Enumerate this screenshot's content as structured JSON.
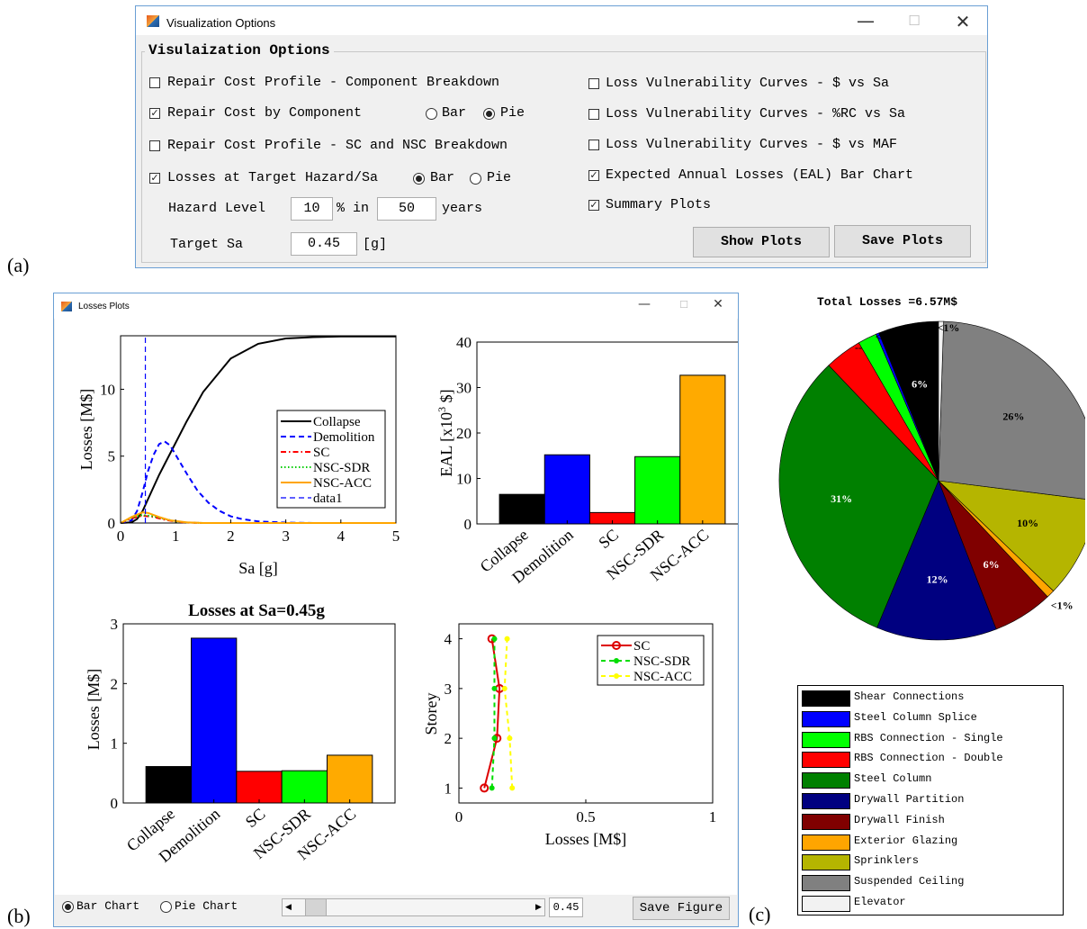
{
  "panel_labels": {
    "a": "(a)",
    "b": "(b)",
    "c": "(c)"
  },
  "options_window": {
    "title": "Visualization Options",
    "group_title": "Visulaization Options",
    "left_options": [
      {
        "label": "Repair Cost Profile - Component Breakdown",
        "checked": false
      },
      {
        "label": "Repair Cost by Component",
        "checked": true
      },
      {
        "label": "Repair Cost Profile - SC and NSC Breakdown",
        "checked": false
      },
      {
        "label": "Losses at Target Hazard/Sa",
        "checked": true
      }
    ],
    "component_chart": {
      "bar_label": "Bar",
      "pie_label": "Pie",
      "selected": "Pie"
    },
    "hazard_chart": {
      "bar_label": "Bar",
      "pie_label": "Pie",
      "selected": "Bar"
    },
    "right_options": [
      {
        "label": "Loss Vulnerability Curves - $ vs Sa",
        "checked": false
      },
      {
        "label": "Loss Vulnerability Curves - %RC vs Sa",
        "checked": false
      },
      {
        "label": "Loss Vulnerability Curves - $ vs MAF",
        "checked": false
      },
      {
        "label": "Expected Annual Losses (EAL) Bar Chart",
        "checked": true
      },
      {
        "label": "Summary Plots",
        "checked": true
      }
    ],
    "hazard_level_label": "Hazard Level",
    "hazard_percent": "10",
    "percent_in_label": "% in",
    "hazard_years": "50",
    "years_label": "years",
    "target_sa_label": "Target Sa",
    "target_sa_value": "0.45",
    "target_sa_unit": "[g]",
    "show_plots_label": "Show Plots",
    "save_plots_label": "Save Plots"
  },
  "plots_window": {
    "title": "Losses Plots",
    "bar_chart_label": "Bar Chart",
    "pie_chart_label": "Pie Chart",
    "selected_mode": "Bar Chart",
    "slider_value": 0.1,
    "slider_readout": "0.45",
    "save_figure_label": "Save Figure"
  },
  "summary_pie_title": "Total Losses =6.57M$",
  "chart_data": [
    {
      "id": "losses-vs-sa",
      "type": "line",
      "xlabel": "Sa [g]",
      "ylabel": "Losses [M$]",
      "xlim": [
        0,
        5
      ],
      "ylim": [
        0,
        14
      ],
      "xticks": [
        "0",
        "1",
        "2",
        "3",
        "4",
        "5"
      ],
      "yticks": [
        "0",
        "5",
        "10"
      ],
      "legend_position": "right",
      "series": [
        {
          "name": "Collapse",
          "color": "#000000",
          "dash": "solid",
          "x": [
            0,
            0.2,
            0.3,
            0.4,
            0.5,
            0.6,
            0.7,
            0.8,
            1.0,
            1.2,
            1.5,
            2.0,
            2.5,
            3.0,
            3.5,
            4.0,
            5.0
          ],
          "y": [
            0,
            0.05,
            0.3,
            0.9,
            1.8,
            2.7,
            3.6,
            4.4,
            6.0,
            7.6,
            9.8,
            12.3,
            13.4,
            13.8,
            13.9,
            13.95,
            13.95
          ]
        },
        {
          "name": "Demolition",
          "color": "#0000ff",
          "dash": "dashed",
          "x": [
            0,
            0.2,
            0.3,
            0.4,
            0.5,
            0.6,
            0.7,
            0.8,
            0.9,
            1.0,
            1.2,
            1.4,
            1.6,
            1.8,
            2.0,
            2.2,
            2.5,
            3.0,
            3.5,
            5.0
          ],
          "y": [
            0,
            0.2,
            0.9,
            2.3,
            3.9,
            5.1,
            5.9,
            6.1,
            5.8,
            5.1,
            3.7,
            2.4,
            1.5,
            0.9,
            0.5,
            0.3,
            0.12,
            0.03,
            0,
            0
          ]
        },
        {
          "name": "SC",
          "color": "#ff0000",
          "dash": "dashdot",
          "x": [
            0,
            0.2,
            0.4,
            0.6,
            0.8,
            1.0,
            1.2,
            1.5,
            5.0
          ],
          "y": [
            0,
            0.35,
            0.55,
            0.45,
            0.25,
            0.1,
            0.03,
            0,
            0
          ]
        },
        {
          "name": "NSC-SDR",
          "color": "#00cc00",
          "dash": "dotted",
          "x": [
            0,
            0.2,
            0.4,
            0.6,
            0.8,
            1.0,
            1.2,
            1.5,
            5.0
          ],
          "y": [
            0,
            0.4,
            0.6,
            0.5,
            0.3,
            0.12,
            0.04,
            0,
            0
          ]
        },
        {
          "name": "NSC-ACC",
          "color": "#ffa500",
          "dash": "solid",
          "x": [
            0,
            0.2,
            0.4,
            0.5,
            0.7,
            0.9,
            1.2,
            1.5,
            5.0
          ],
          "y": [
            0,
            0.45,
            0.8,
            0.75,
            0.45,
            0.2,
            0.05,
            0,
            0
          ]
        },
        {
          "name": "data1",
          "color": "#0000ff",
          "dash": "dashed",
          "x": [
            0.45,
            0.45
          ],
          "y": [
            0,
            14
          ]
        }
      ]
    },
    {
      "id": "eal-bar",
      "type": "bar",
      "ylabel": "EAL [x10^3 $]",
      "ylim": [
        0,
        40
      ],
      "yticks": [
        "0",
        "10",
        "20",
        "30",
        "40"
      ],
      "categories": [
        "Collapse",
        "Demolition",
        "SC",
        "NSC-SDR",
        "NSC-ACC"
      ],
      "values": [
        6.5,
        15.2,
        2.5,
        14.8,
        32.7
      ],
      "colors": [
        "#000000",
        "#0000ff",
        "#ff0000",
        "#00ff00",
        "#ffaa00"
      ]
    },
    {
      "id": "losses-at-sa-bar",
      "type": "bar",
      "title": "Losses at Sa=0.45g",
      "ylabel": "Losses [M$]",
      "ylim": [
        0,
        3
      ],
      "yticks": [
        "0",
        "1",
        "2",
        "3"
      ],
      "categories": [
        "Collapse",
        "Demolition",
        "SC",
        "NSC-SDR",
        "NSC-ACC"
      ],
      "values": [
        0.61,
        2.76,
        0.53,
        0.54,
        0.8
      ],
      "colors": [
        "#000000",
        "#0000ff",
        "#ff0000",
        "#00ff00",
        "#ffaa00"
      ]
    },
    {
      "id": "storey-profile",
      "type": "line",
      "xlabel": "Losses [M$]",
      "ylabel": "Storey",
      "xlim": [
        0,
        1
      ],
      "ylim": [
        0.7,
        4.3
      ],
      "xticks": [
        "0",
        "0.5",
        "1"
      ],
      "yticks": [
        "1",
        "2",
        "3",
        "4"
      ],
      "legend_position": "top-right",
      "series": [
        {
          "name": "SC",
          "color": "#dd0000",
          "marker": "circle",
          "x": [
            0.1,
            0.15,
            0.16,
            0.13
          ],
          "y": [
            1,
            2,
            3,
            4
          ]
        },
        {
          "name": "NSC-SDR",
          "color": "#00dd00",
          "marker": "dot",
          "x": [
            0.13,
            0.14,
            0.14,
            0.14
          ],
          "y": [
            1,
            2,
            3,
            4
          ]
        },
        {
          "name": "NSC-ACC",
          "color": "#ffff00",
          "marker": "dot",
          "x": [
            0.21,
            0.2,
            0.18,
            0.19
          ],
          "y": [
            1,
            2,
            3,
            4
          ]
        }
      ]
    },
    {
      "id": "component-pie",
      "type": "pie",
      "title": "Total Losses =6.57M$",
      "slices": [
        {
          "name": "Shear Connections",
          "percent": 6,
          "label": "6%",
          "color": "#000000"
        },
        {
          "name": "Steel Column Splice",
          "percent": 0.3,
          "label": "",
          "color": "#0000ff"
        },
        {
          "name": "RBS Connection - Single",
          "percent": 1.9,
          "label": "",
          "color": "#00ff00"
        },
        {
          "name": "RBS Connection - Double",
          "percent": 3.7,
          "label": "",
          "color": "#ff0000"
        },
        {
          "name": "Steel Column",
          "percent": 31,
          "label": "31%",
          "color": "#008000"
        },
        {
          "name": "Drywall Partition",
          "percent": 12,
          "label": "12%",
          "color": "#000080"
        },
        {
          "name": "Drywall Finish",
          "percent": 6,
          "label": "6%",
          "color": "#800000"
        },
        {
          "name": "Exterior Glazing",
          "percent": 0.8,
          "label": "<1%",
          "color": "#ffa500"
        },
        {
          "name": "Sprinklers",
          "percent": 10,
          "label": "10%",
          "color": "#b5b500"
        },
        {
          "name": "Suspended Ceiling",
          "percent": 26,
          "label": "26%",
          "color": "#808080"
        },
        {
          "name": "Elevator",
          "percent": 0.5,
          "label": "<1%",
          "color": "#f2f2f2"
        }
      ],
      "outside_labels": [
        "<1%",
        "<1%",
        "<1%",
        "--"
      ]
    }
  ]
}
